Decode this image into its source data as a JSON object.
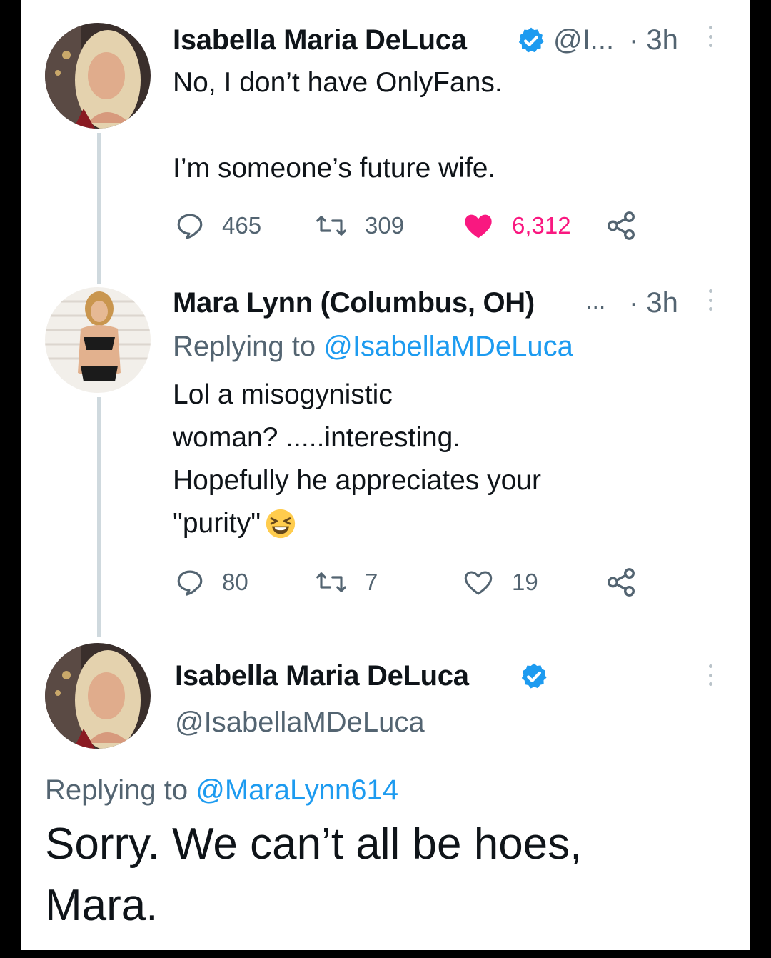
{
  "colors": {
    "like": "#f91880",
    "link": "#1d9bf0",
    "verified": "#1d9bf0",
    "secondary_text": "#536471"
  },
  "tweet1": {
    "name": "Isabella Maria DeLuca",
    "handle": "@I...",
    "time": "· 3h",
    "body_line1": "No, I don’t have OnlyFans.",
    "body_line2": "I’m someone’s future wife.",
    "replies": "465",
    "retweets": "309",
    "likes": "6,312",
    "liked": true
  },
  "tweet2": {
    "name": "Mara Lynn (Columbus, OH)",
    "name_ellipsis": "...",
    "time": "· 3h",
    "replying_label": "Replying to ",
    "replying_handle": "@IsabellaMDeLuca",
    "body_line1": "Lol a misogynistic",
    "body_line2": "woman? .....interesting.",
    "body_line3": "Hopefully he appreciates your",
    "body_line4": "\"purity\"",
    "emoji": "grinning-squinting-face",
    "replies": "80",
    "retweets": "7",
    "likes": "19",
    "liked": false
  },
  "tweet3": {
    "name": "Isabella Maria DeLuca",
    "handle": "@IsabellaMDeLuca",
    "replying_label": "Replying to ",
    "replying_handle": "@MaraLynn614",
    "body_line1": "Sorry. We can’t all be hoes,",
    "body_line2": "Mara."
  }
}
